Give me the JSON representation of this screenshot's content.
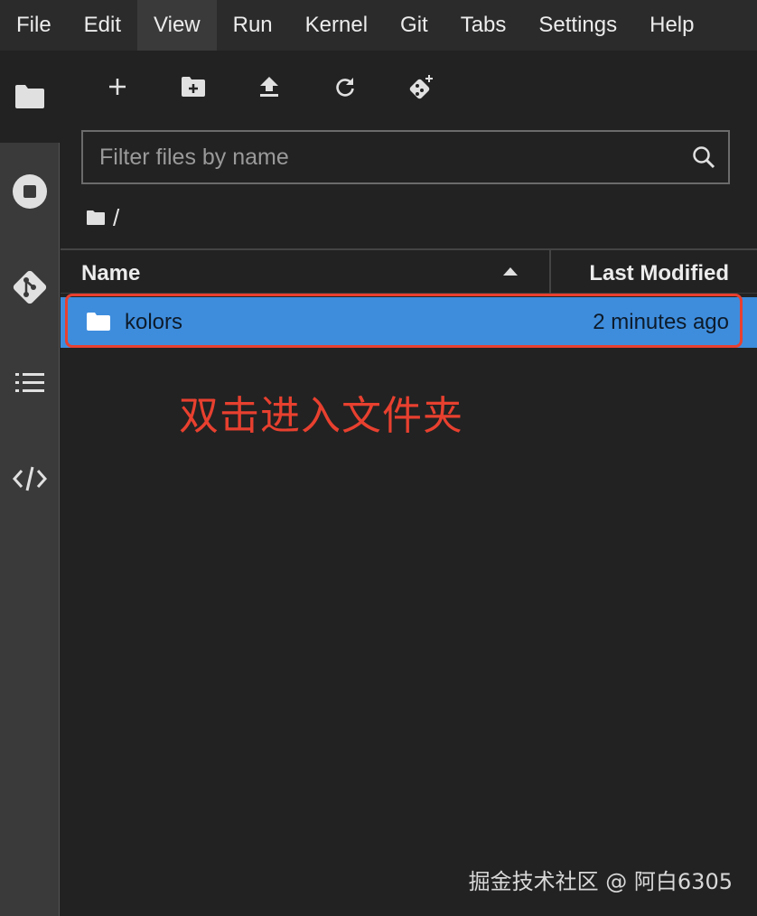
{
  "menu": {
    "items": [
      {
        "label": "File"
      },
      {
        "label": "Edit"
      },
      {
        "label": "View",
        "active": true
      },
      {
        "label": "Run"
      },
      {
        "label": "Kernel"
      },
      {
        "label": "Git"
      },
      {
        "label": "Tabs"
      },
      {
        "label": "Settings"
      },
      {
        "label": "Help"
      }
    ]
  },
  "sidebar": {
    "icons": [
      "folder-icon",
      "stop-circle-icon",
      "git-icon",
      "list-icon",
      "code-icon"
    ]
  },
  "toolbar": {
    "icons": [
      "plus-icon",
      "new-folder-icon",
      "upload-icon",
      "refresh-icon",
      "git-clone-icon"
    ]
  },
  "filter": {
    "placeholder": "Filter files by name",
    "value": ""
  },
  "breadcrumb": {
    "path": "/"
  },
  "list": {
    "columns": {
      "name": "Name",
      "modified": "Last Modified"
    },
    "sort": "ascending",
    "rows": [
      {
        "name": "kolors",
        "modified": "2 minutes ago",
        "type": "folder",
        "selected": true
      }
    ]
  },
  "annotation": {
    "text": "双击进入文件夹",
    "color": "#e8402f"
  },
  "watermark": {
    "text": "掘金技术社区 @ 阿白6305"
  },
  "colors": {
    "background": "#222222",
    "menubar": "#2b2b2b",
    "activitybar": "#3a3a3a",
    "selected_row": "#3e8ddd",
    "highlight": "#e8402f"
  }
}
